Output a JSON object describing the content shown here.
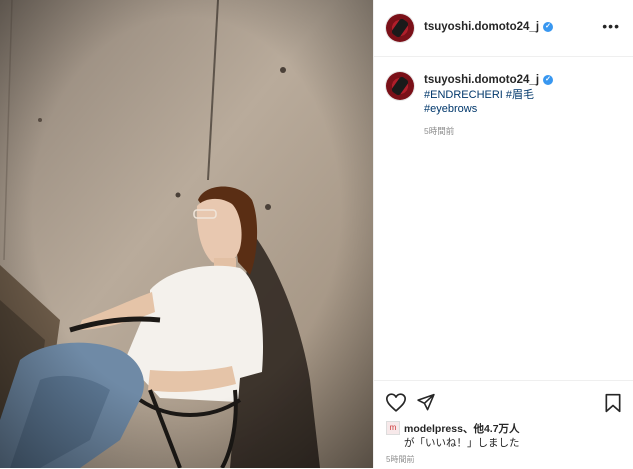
{
  "post": {
    "username": "tsuyoshi.domoto24_j",
    "hashtags": [
      "#ENDRECHERI",
      "#眉毛",
      "#eyebrows"
    ],
    "caption_time": "5時間前"
  },
  "icons": {
    "more": "more-options-icon",
    "verified": "verified-badge-icon",
    "like": "heart-icon",
    "share": "send-icon",
    "save": "bookmark-icon"
  },
  "likes": {
    "user": "modelpress",
    "suffix": "、他4.7万人",
    "line2": "が「いいね！」しました"
  },
  "footer_time": "5時間前",
  "colors": {
    "verified": "#3897f0",
    "hashtag": "#00376b",
    "muted": "#8e8e8e"
  }
}
